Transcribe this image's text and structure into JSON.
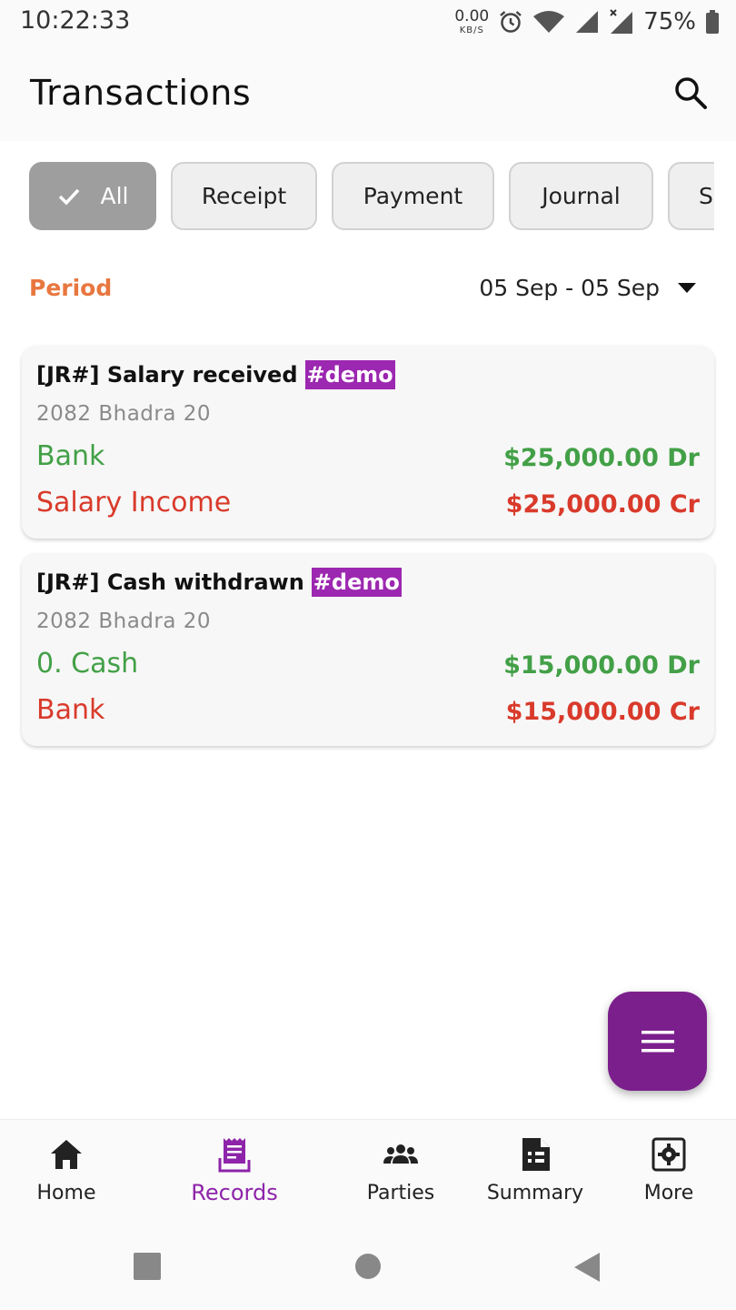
{
  "status_bar": {
    "time": "10:22:33",
    "net_speed_value": "0.00",
    "net_speed_unit": "KB/S",
    "battery": "75%"
  },
  "header": {
    "title": "Transactions"
  },
  "filters": {
    "chips": [
      "All",
      "Receipt",
      "Payment",
      "Journal",
      "S"
    ],
    "selected": "All"
  },
  "period": {
    "label": "Period",
    "value": "05 Sep - 05 Sep"
  },
  "transactions": [
    {
      "title": "[JR#] Salary received",
      "tag": "#demo",
      "date": "2082 Bhadra 20",
      "debit_account": "Bank",
      "debit_amount": "$25,000.00 Dr",
      "credit_account": "Salary Income",
      "credit_amount": "$25,000.00 Cr"
    },
    {
      "title": "[JR#] Cash withdrawn",
      "tag": "#demo",
      "date": "2082 Bhadra 20",
      "debit_account": "0. Cash",
      "debit_amount": "$15,000.00 Dr",
      "credit_account": "Bank",
      "credit_amount": "$15,000.00 Cr"
    }
  ],
  "bottom_nav": {
    "items": [
      {
        "label": "Home",
        "icon": "home-icon"
      },
      {
        "label": "Records",
        "icon": "receipt-icon"
      },
      {
        "label": "Parties",
        "icon": "groups-icon"
      },
      {
        "label": "Summary",
        "icon": "document-icon"
      },
      {
        "label": "More",
        "icon": "settings-icon"
      }
    ],
    "active": "Records"
  },
  "colors": {
    "accent_purple": "#7b1f8c",
    "debit_green": "#43a047",
    "credit_red": "#d93a2b",
    "period_orange": "#e8773f",
    "tag_purple": "#9c27b0"
  }
}
